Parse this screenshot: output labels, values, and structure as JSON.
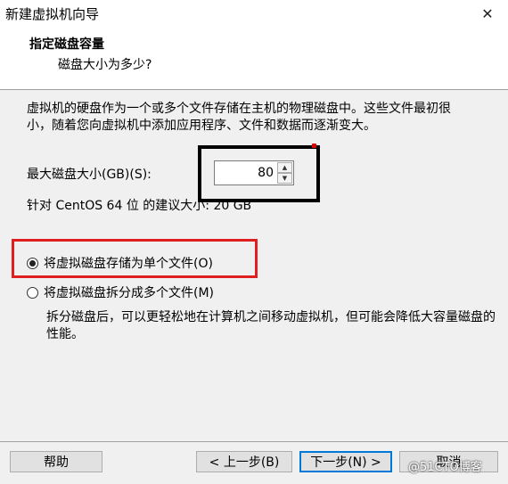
{
  "window": {
    "title": "新建虚拟机向导",
    "close_glyph": "✕"
  },
  "header": {
    "title": "指定磁盘容量",
    "subtitle": "磁盘大小为多少?"
  },
  "content": {
    "description": "虚拟机的硬盘作为一个或多个文件存储在主机的物理磁盘中。这些文件最初很小，随着您向虚拟机中添加应用程序、文件和数据而逐渐变大。",
    "max_size_label": "最大磁盘大小(GB)(S):",
    "max_size_value": "80",
    "recommend": "针对 CentOS 64 位 的建议大小: 20 GB",
    "options": [
      {
        "label": "将虚拟磁盘存储为单个文件(O)",
        "selected": true
      },
      {
        "label": "将虚拟磁盘拆分成多个文件(M)",
        "selected": false
      }
    ],
    "split_description": "拆分磁盘后，可以更轻松地在计算机之间移动虚拟机，但可能会降低大容量磁盘的性能。"
  },
  "footer": {
    "help": "帮助",
    "back": "< 上一步(B)",
    "next": "下一步(N) >",
    "cancel": "取消",
    "watermark": "@51CTO博客"
  },
  "colors": {
    "highlight_red": "#e02020",
    "highlight_black": "#000000",
    "focus_blue": "#0078d7"
  }
}
